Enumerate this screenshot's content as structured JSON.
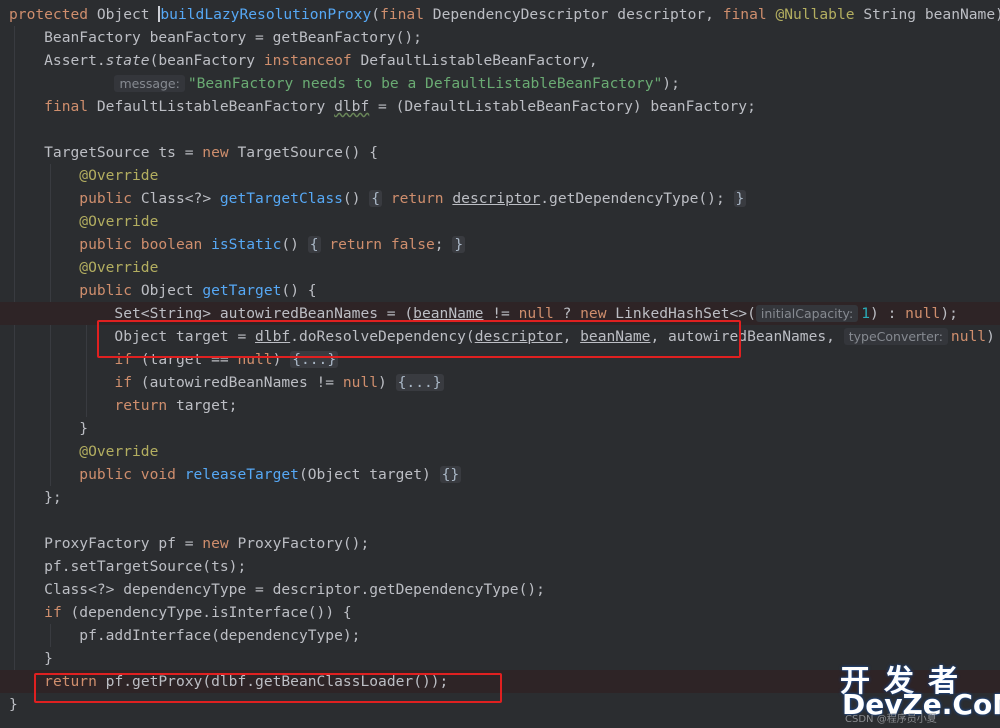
{
  "editor": {
    "lines": [
      {
        "segs": [
          [
            "kw",
            "protected "
          ],
          [
            "ty",
            "Object "
          ],
          [
            "caret",
            ""
          ],
          [
            "fnd",
            "buildLazyResolutionProxy"
          ],
          [
            "ty",
            "("
          ],
          [
            "kw",
            "final "
          ],
          [
            "ty",
            "DependencyDescriptor descriptor, "
          ],
          [
            "kw",
            "final "
          ],
          [
            "ann",
            "@Nullable "
          ],
          [
            "ty",
            "String beanName)"
          ]
        ]
      },
      {
        "segs": [
          [
            "ty",
            "    BeanFactory beanFactory = getBeanFactory();"
          ]
        ]
      },
      {
        "segs": [
          [
            "ty",
            "    Assert."
          ],
          [
            "ital",
            "state"
          ],
          [
            "ty",
            "(beanFactory "
          ],
          [
            "kw",
            "instanceof "
          ],
          [
            "ty",
            "DefaultListableBeanFactory,"
          ]
        ]
      },
      {
        "segs": [
          [
            "ty",
            "            "
          ],
          [
            "hint",
            "message:"
          ],
          [
            "str",
            "\"BeanFactory needs to be a DefaultListableBeanFactory\""
          ],
          [
            "ty",
            ");"
          ]
        ]
      },
      {
        "segs": [
          [
            "ty",
            "    "
          ],
          [
            "kw",
            "final "
          ],
          [
            "ty",
            "DefaultListableBeanFactory "
          ],
          [
            "wavy",
            "dlbf"
          ],
          [
            "ty",
            " = (DefaultListableBeanFactory) beanFactory;"
          ]
        ]
      },
      {
        "segs": []
      },
      {
        "segs": [
          [
            "ty",
            "    TargetSource ts = "
          ],
          [
            "kw",
            "new "
          ],
          [
            "ty",
            "TargetSource() {"
          ]
        ]
      },
      {
        "segs": [
          [
            "ty",
            "        "
          ],
          [
            "ann",
            "@Override"
          ]
        ]
      },
      {
        "segs": [
          [
            "ty",
            "        "
          ],
          [
            "kw",
            "public "
          ],
          [
            "ty",
            "Class<?> "
          ],
          [
            "fnd",
            "getTargetClass"
          ],
          [
            "ty",
            "() "
          ],
          [
            "fold",
            "{"
          ],
          [
            "ty",
            " "
          ],
          [
            "kw",
            "return "
          ],
          [
            "ul",
            "descriptor"
          ],
          [
            "ty",
            ".getDependencyType(); "
          ],
          [
            "fold",
            "}"
          ]
        ]
      },
      {
        "segs": [
          [
            "ty",
            "        "
          ],
          [
            "ann",
            "@Override"
          ]
        ]
      },
      {
        "segs": [
          [
            "ty",
            "        "
          ],
          [
            "kw",
            "public boolean "
          ],
          [
            "fnd",
            "isStatic"
          ],
          [
            "ty",
            "() "
          ],
          [
            "fold",
            "{"
          ],
          [
            "ty",
            " "
          ],
          [
            "kw",
            "return false"
          ],
          [
            "ty",
            "; "
          ],
          [
            "fold",
            "}"
          ]
        ]
      },
      {
        "segs": [
          [
            "ty",
            "        "
          ],
          [
            "ann",
            "@Override"
          ]
        ]
      },
      {
        "segs": [
          [
            "ty",
            "        "
          ],
          [
            "kw",
            "public "
          ],
          [
            "ty",
            "Object "
          ],
          [
            "fnd",
            "getTarget"
          ],
          [
            "ty",
            "() {"
          ]
        ]
      },
      {
        "segs": [
          [
            "ty",
            "            Set<String> autowiredBeanNames = ("
          ],
          [
            "ul",
            "beanName"
          ],
          [
            "ty",
            " != "
          ],
          [
            "kw",
            "null"
          ],
          [
            "ty",
            " ? "
          ],
          [
            "kw",
            "new "
          ],
          [
            "ty",
            "LinkedHashSet<>("
          ],
          [
            "hint",
            "initialCapacity:"
          ],
          [
            "num",
            "1"
          ],
          [
            "ty",
            ") : "
          ],
          [
            "kw",
            "null"
          ],
          [
            "ty",
            ");"
          ]
        ]
      },
      {
        "segs": [
          [
            "ty",
            "            Object target = "
          ],
          [
            "ul",
            "dlbf"
          ],
          [
            "ty",
            ".doResolveDependency("
          ],
          [
            "ul",
            "descriptor"
          ],
          [
            "ty",
            ", "
          ],
          [
            "ul",
            "beanName"
          ],
          [
            "ty",
            ", autowiredBeanNames, "
          ],
          [
            "hint",
            "typeConverter:"
          ],
          [
            "kw",
            "null"
          ],
          [
            "ty",
            ")"
          ]
        ]
      },
      {
        "segs": [
          [
            "ty",
            "            "
          ],
          [
            "kw",
            "if "
          ],
          [
            "ty",
            "(target == "
          ],
          [
            "kw",
            "null"
          ],
          [
            "ty",
            ") "
          ],
          [
            "fold",
            "{...}"
          ]
        ]
      },
      {
        "segs": [
          [
            "ty",
            "            "
          ],
          [
            "kw",
            "if "
          ],
          [
            "ty",
            "(autowiredBeanNames != "
          ],
          [
            "kw",
            "null"
          ],
          [
            "ty",
            ") "
          ],
          [
            "fold",
            "{...}"
          ]
        ]
      },
      {
        "segs": [
          [
            "ty",
            "            "
          ],
          [
            "kw",
            "return "
          ],
          [
            "ty",
            "target;"
          ]
        ]
      },
      {
        "segs": [
          [
            "ty",
            "        }"
          ]
        ]
      },
      {
        "segs": [
          [
            "ty",
            "        "
          ],
          [
            "ann",
            "@Override"
          ]
        ]
      },
      {
        "segs": [
          [
            "ty",
            "        "
          ],
          [
            "kw",
            "public void "
          ],
          [
            "fnd",
            "releaseTarget"
          ],
          [
            "ty",
            "(Object target) "
          ],
          [
            "fold",
            "{}"
          ]
        ]
      },
      {
        "segs": [
          [
            "ty",
            "    };"
          ]
        ]
      },
      {
        "segs": []
      },
      {
        "segs": [
          [
            "ty",
            "    ProxyFactory pf = "
          ],
          [
            "kw",
            "new "
          ],
          [
            "ty",
            "ProxyFactory();"
          ]
        ]
      },
      {
        "segs": [
          [
            "ty",
            "    pf.setTargetSource(ts);"
          ]
        ]
      },
      {
        "segs": [
          [
            "ty",
            "    Class<?> dependencyType = descriptor.getDependencyType();"
          ]
        ]
      },
      {
        "segs": [
          [
            "ty",
            "    "
          ],
          [
            "kw",
            "if "
          ],
          [
            "ty",
            "(dependencyType.isInterface()) {"
          ]
        ]
      },
      {
        "segs": [
          [
            "ty",
            "        pf.addInterface(dependencyType);"
          ]
        ]
      },
      {
        "segs": [
          [
            "ty",
            "    }"
          ]
        ]
      },
      {
        "segs": [
          [
            "ty",
            "    "
          ],
          [
            "kw",
            "return "
          ],
          [
            "ty",
            "pf.getProxy(dlbf.getBeanClassLoader());"
          ]
        ]
      },
      {
        "segs": [
          [
            "ty",
            "}"
          ]
        ]
      }
    ]
  },
  "watermark": {
    "cn": "开发者",
    "en": "DevZe.CoM",
    "small": "CSDN @程序员小夏"
  },
  "colors": {
    "background": "#2b2d30",
    "keyword": "#cf8e6d",
    "string": "#6aab73",
    "annotation": "#b3ae60",
    "highlight_box": "#e02020"
  }
}
